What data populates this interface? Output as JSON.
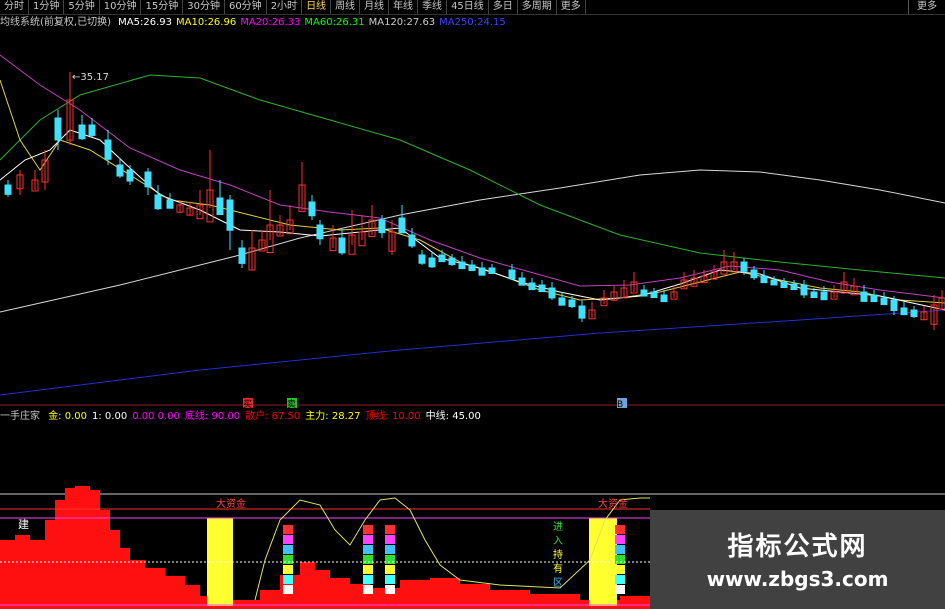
{
  "toolbar": {
    "tabs": [
      "分时",
      "1分钟",
      "5分钟",
      "10分钟",
      "15分钟",
      "30分钟",
      "60分钟",
      "2小时",
      "日线",
      "周线",
      "月线",
      "年线",
      "季线",
      "45日线",
      "多日",
      "多周期",
      "更多"
    ],
    "active_index": 8,
    "right_button": "更多"
  },
  "main_indicator": {
    "title": "均线系统(前复权,已切换)",
    "items": [
      {
        "label": "MA5:",
        "value": "26.93",
        "color": "#ffffff"
      },
      {
        "label": "MA10:",
        "value": "26.96",
        "color": "#ffff00"
      },
      {
        "label": "MA20:",
        "value": "26.33",
        "color": "#ff00ff"
      },
      {
        "label": "MA60:",
        "value": "26.31",
        "color": "#00ff00"
      },
      {
        "label": "MA120:",
        "value": "27.63",
        "color": "#cccccc"
      },
      {
        "label": "MA250:",
        "value": "24.15",
        "color": "#4040ff"
      }
    ],
    "high_label": "35.17"
  },
  "markers": {
    "m1": "买",
    "m2": "卖",
    "m3": "B"
  },
  "sub_indicator": {
    "title": "一手庄家",
    "items": [
      {
        "label": "金:",
        "value": "0.00",
        "color": "#ffff00"
      },
      {
        "label": "1:",
        "value": "0.00",
        "color": "#ffffff"
      },
      {
        "label": "0.00",
        "value": "0.00",
        "color": "#ff00ff"
      },
      {
        "label": "底线:",
        "value": "90.00",
        "color": "#ff00ff"
      },
      {
        "label": "散户:",
        "value": "67.50",
        "color": "#ff0000"
      },
      {
        "label": "主力:",
        "value": "28.27",
        "color": "#ffff00"
      },
      {
        "label": "顶线:",
        "value": "10.00",
        "color": "#ff0000"
      },
      {
        "label": "中线:",
        "value": "45.00",
        "color": "#ffffff"
      }
    ],
    "zone_labels": [
      "大资金",
      "大资金"
    ],
    "side_labels": [
      "进",
      "入",
      "持",
      "有",
      "区"
    ],
    "left_label": "建"
  },
  "watermark": {
    "line1": "指标公式网",
    "line2": "www.zbgs3.com"
  },
  "colors": {
    "up": "#ff3030",
    "down": "#40e0ff",
    "bg": "#000000"
  }
}
